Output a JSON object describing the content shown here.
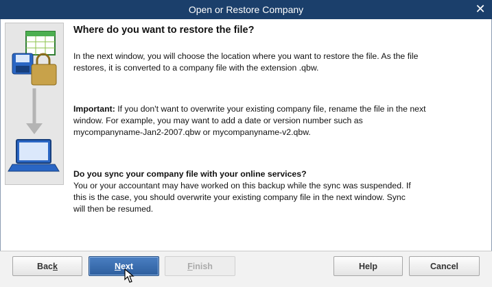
{
  "window": {
    "title": "Open or Restore Company",
    "close_glyph": "✕"
  },
  "content": {
    "heading": "Where do you want to restore the file?",
    "intro": "In the next window, you will choose the location where you want to restore the file. As the file restores, it is converted to a company file with the extension .qbw.",
    "important_label": "Important:",
    "important_text": " If you don't want to overwrite your existing company file, rename the file in the next window. For example, you may want to add a date or version number such as mycompanyname-Jan2-2007.qbw or mycompanyname-v2.qbw.",
    "sync_heading": "Do you sync your company file with your online services?",
    "sync_text": "You or your accountant may have worked on this backup while the sync was suspended. If this is the case, you should overwrite your existing company file in the next window. Sync will then be resumed."
  },
  "buttons": {
    "back": {
      "pre": "Bac",
      "u": "k",
      "post": ""
    },
    "next": {
      "pre": "",
      "u": "N",
      "post": "ext"
    },
    "finish": {
      "pre": "",
      "u": "F",
      "post": "inish"
    },
    "help": "Help",
    "cancel": "Cancel"
  },
  "icons": [
    "spreadsheet-icon",
    "disk-icon",
    "lock-icon",
    "down-arrow-icon",
    "laptop-icon",
    "pointer-cursor-icon"
  ],
  "colors": {
    "titlebar": "#1b3f6b",
    "primary_button": "#2d5e9e"
  }
}
